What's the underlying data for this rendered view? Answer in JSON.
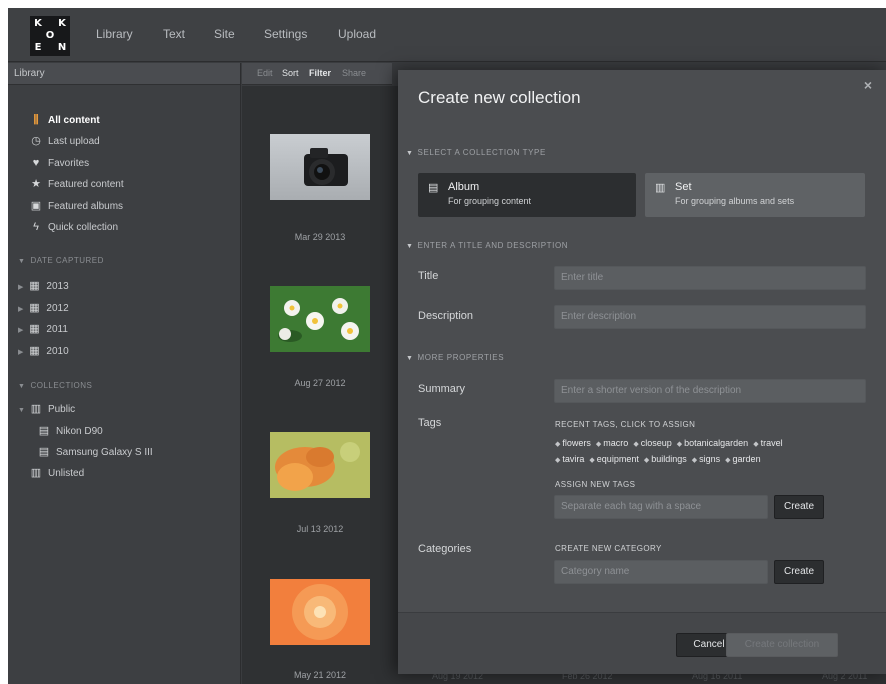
{
  "logo": {
    "letters": [
      "K",
      "K",
      "O",
      "E",
      "N"
    ]
  },
  "nav": {
    "items": [
      "Library",
      "Text",
      "Site",
      "Settings",
      "Upload"
    ]
  },
  "sidebar": {
    "header": "Library",
    "items": [
      {
        "label": "All content",
        "icon": "library-icon"
      },
      {
        "label": "Last upload",
        "icon": "clock-icon"
      },
      {
        "label": "Favorites",
        "icon": "heart-icon"
      },
      {
        "label": "Featured content",
        "icon": "star-icon"
      },
      {
        "label": "Featured albums",
        "icon": "featured-album-icon"
      },
      {
        "label": "Quick collection",
        "icon": "lightning-icon"
      }
    ],
    "date_section": "DATE CAPTURED",
    "years": [
      "2013",
      "2012",
      "2011",
      "2010"
    ],
    "collections_section": "COLLECTIONS",
    "collections": {
      "public": "Public",
      "children": [
        "Nikon D90",
        "Samsung Galaxy S III"
      ],
      "unlisted": "Unlisted"
    }
  },
  "toolbar": {
    "edit": "Edit",
    "sort": "Sort",
    "filter": "Filter",
    "share": "Share"
  },
  "grid": {
    "dates": [
      "Mar 29 2013",
      "Aug 27 2012",
      "Jul 13 2012",
      "May 21 2012"
    ],
    "bottom_dates": [
      "Aug 19 2012",
      "Feb 26 2012",
      "Aug 16 2011",
      "Aug 2 2011"
    ]
  },
  "modal": {
    "title": "Create new collection",
    "close": "×",
    "section_type": "SELECT A COLLECTION TYPE",
    "types": [
      {
        "name": "Album",
        "desc": "For grouping content",
        "selected": true
      },
      {
        "name": "Set",
        "desc": "For grouping albums and sets",
        "selected": false
      }
    ],
    "section_title": "ENTER A TITLE AND DESCRIPTION",
    "title_label": "Title",
    "title_placeholder": "Enter title",
    "description_label": "Description",
    "description_placeholder": "Enter description",
    "section_more": "MORE PROPERTIES",
    "summary_label": "Summary",
    "summary_placeholder": "Enter a shorter version of the description",
    "tags_label": "Tags",
    "recent_tags_heading": "RECENT TAGS, CLICK TO ASSIGN",
    "recent_tags_row1": [
      "flowers",
      "macro",
      "closeup",
      "botanicalgarden",
      "travel"
    ],
    "recent_tags_row2": [
      "tavira",
      "equipment",
      "buildings",
      "signs",
      "garden"
    ],
    "assign_heading": "ASSIGN NEW TAGS",
    "tags_placeholder": "Separate each tag with a space",
    "create_tags_button": "Create",
    "categories_label": "Categories",
    "category_heading": "CREATE NEW CATEGORY",
    "category_placeholder": "Category name",
    "create_category_button": "Create",
    "cancel_button": "Cancel",
    "create_collection_button": "Create collection"
  },
  "colors": {
    "accent": "#e89a3c",
    "modal_bg": "#4b4d50",
    "selected_type": "#2c2e30"
  }
}
